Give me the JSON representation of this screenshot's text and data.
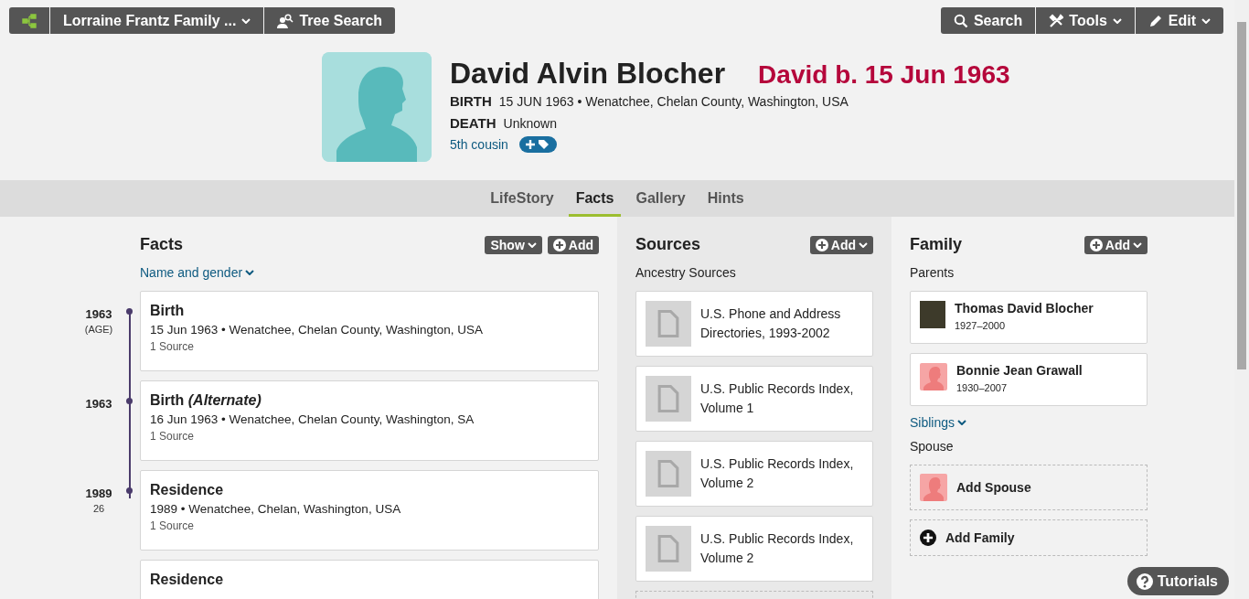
{
  "toolbar": {
    "tree_name": "Lorraine Frantz Family ...",
    "tree_search": "Tree Search",
    "right_buttons": [
      {
        "label": "Search",
        "kind": "search",
        "dropdown": false
      },
      {
        "label": "Tools",
        "kind": "tools",
        "dropdown": true
      },
      {
        "label": "Edit",
        "kind": "edit",
        "dropdown": true
      }
    ]
  },
  "profile": {
    "name": "David Alvin Blocher",
    "annotation": "David b. 15 Jun 1963",
    "facts": [
      {
        "label": "BIRTH",
        "value": "15 JUN 1963 • Wenatchee, Chelan County, Washington, USA"
      },
      {
        "label": "DEATH",
        "value": "Unknown"
      }
    ],
    "relationship": "5th cousin"
  },
  "tabs": [
    {
      "label": "LifeStory",
      "selected": false
    },
    {
      "label": "Facts",
      "selected": true
    },
    {
      "label": "Gallery",
      "selected": false
    },
    {
      "label": "Hints",
      "selected": false
    }
  ],
  "facts": {
    "title": "Facts",
    "show": "Show",
    "add": "Add",
    "name_and_gender": "Name and gender",
    "items": [
      {
        "year": "1963",
        "age": "(AGE)",
        "title": "Birth",
        "detail": "15 Jun 1963 • Wenatchee, Chelan County, Washington, USA",
        "sources": "1 Source"
      },
      {
        "year": "1963",
        "title": "Birth *(Alternate)*",
        "detail": "16 Jun 1963 • Wenatchee, Chelan County, Washington, SA",
        "sources": "1 Source"
      },
      {
        "year": "1989",
        "age": "26",
        "title": "Residence",
        "detail": "1989 • Wenatchee, Chelan, Washington, USA",
        "sources": "1 Source"
      },
      {
        "title": "Residence"
      }
    ]
  },
  "sources": {
    "title": "Sources",
    "add": "Add",
    "subtitle": "Ancestry Sources",
    "items": [
      "U.S. Phone and Address Directories, 1993-2002",
      "U.S. Public Records Index, Volume 1",
      "U.S. Public Records Index, Volume 2",
      "U.S. Public Records Index, Volume 2"
    ]
  },
  "family": {
    "title": "Family",
    "add": "Add",
    "parents_label": "Parents",
    "parents": [
      {
        "name": "Thomas David Blocher",
        "years": "1927–2000",
        "kind": "photo"
      },
      {
        "name": "Bonnie Jean Grawall",
        "years": "1930–2007",
        "kind": "silhouette"
      }
    ],
    "siblings": "Siblings",
    "spouse_label": "Spouse",
    "add_spouse": "Add Spouse",
    "add_family": "Add Family"
  },
  "tutorials": "Tutorials"
}
